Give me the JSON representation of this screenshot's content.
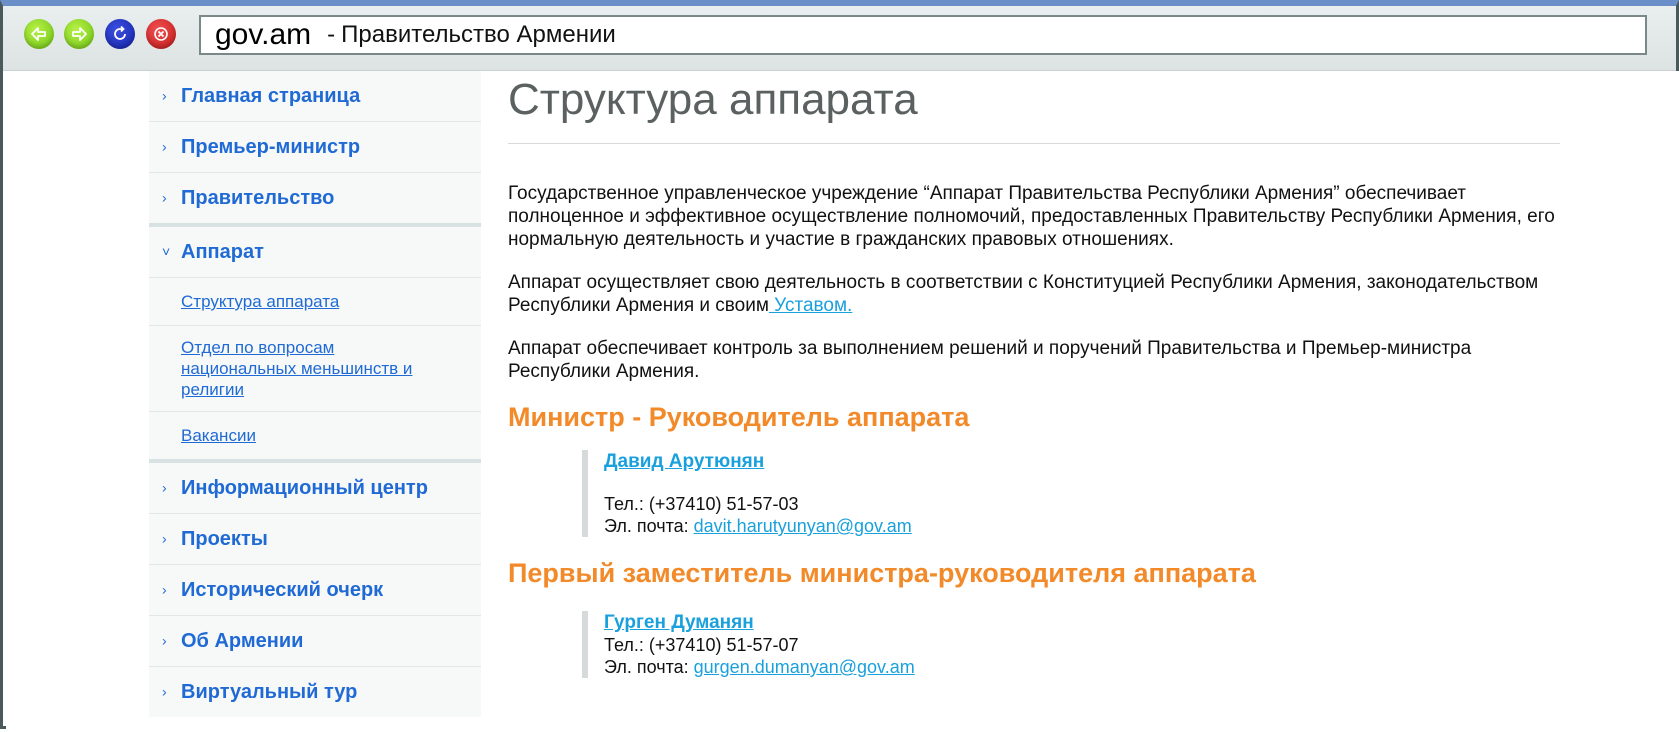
{
  "browser": {
    "domain": "gov.am",
    "separator": "-",
    "page_title": "Правительство Армении"
  },
  "sidebar": {
    "items": [
      {
        "label": "Главная страница",
        "chevron": "›"
      },
      {
        "label": "Премьер-министр",
        "chevron": "›"
      },
      {
        "label": "Правительство",
        "chevron": "›"
      },
      {
        "label": "Аппарат",
        "chevron": "˅"
      },
      {
        "label": "Информационный центр",
        "chevron": "›"
      },
      {
        "label": "Проекты",
        "chevron": "›"
      },
      {
        "label": "Исторический очерк",
        "chevron": "›"
      },
      {
        "label": "Об Армении",
        "chevron": "›"
      },
      {
        "label": "Виртуальный тур",
        "chevron": "›"
      }
    ],
    "subitems": [
      {
        "label": "Структура аппарата"
      },
      {
        "label": "Отдел по вопросам национальных меньшинств и религии"
      },
      {
        "label": "Вакансии"
      }
    ]
  },
  "main": {
    "title": "Структура аппарата",
    "paragraph1": "Государственное управленческое учреждение “Аппарат Правительства Республики Армения” обеспечивает полноценное и эффективное осуществление полномочий, предоставленных Правительству Республики Армения, его нормальную деятельность и участие в гражданских правовых отношениях.",
    "paragraph2_text": "Аппарат осуществляет свою деятельность в соответствии с Конституцией Республики Армения, законодательством Республики Армения и своим",
    "paragraph2_link": " Уставом.",
    "paragraph3": "Аппарат обеспечивает контроль за выполнением решений и поручений Правительства и Премьер-министра Республики Армения.",
    "sections": [
      {
        "title": "Министр - Руководитель аппарата",
        "name": "Давид Арутюнян",
        "phone": "Тел.: (+37410) 51-57-03",
        "email_label": "Эл. почта:",
        "email": "davit.harutyunyan@gov.am"
      },
      {
        "title": "Первый заместитель министра-руководителя аппарата",
        "name": "Гурген Думанян",
        "phone": "Тел.: (+37410) 51-57-07",
        "email_label": "Эл. почта:",
        "email": "gurgen.dumanyan@gov.am"
      }
    ]
  },
  "colors": {
    "link": "#1f6ad4",
    "accent_orange": "#f28a2a",
    "contact_link": "#1aa0dd",
    "title_gray": "#5b6161"
  },
  "icons": {
    "back": "back-arrow-icon",
    "forward": "forward-arrow-icon",
    "reload": "reload-icon",
    "stop": "stop-icon"
  }
}
